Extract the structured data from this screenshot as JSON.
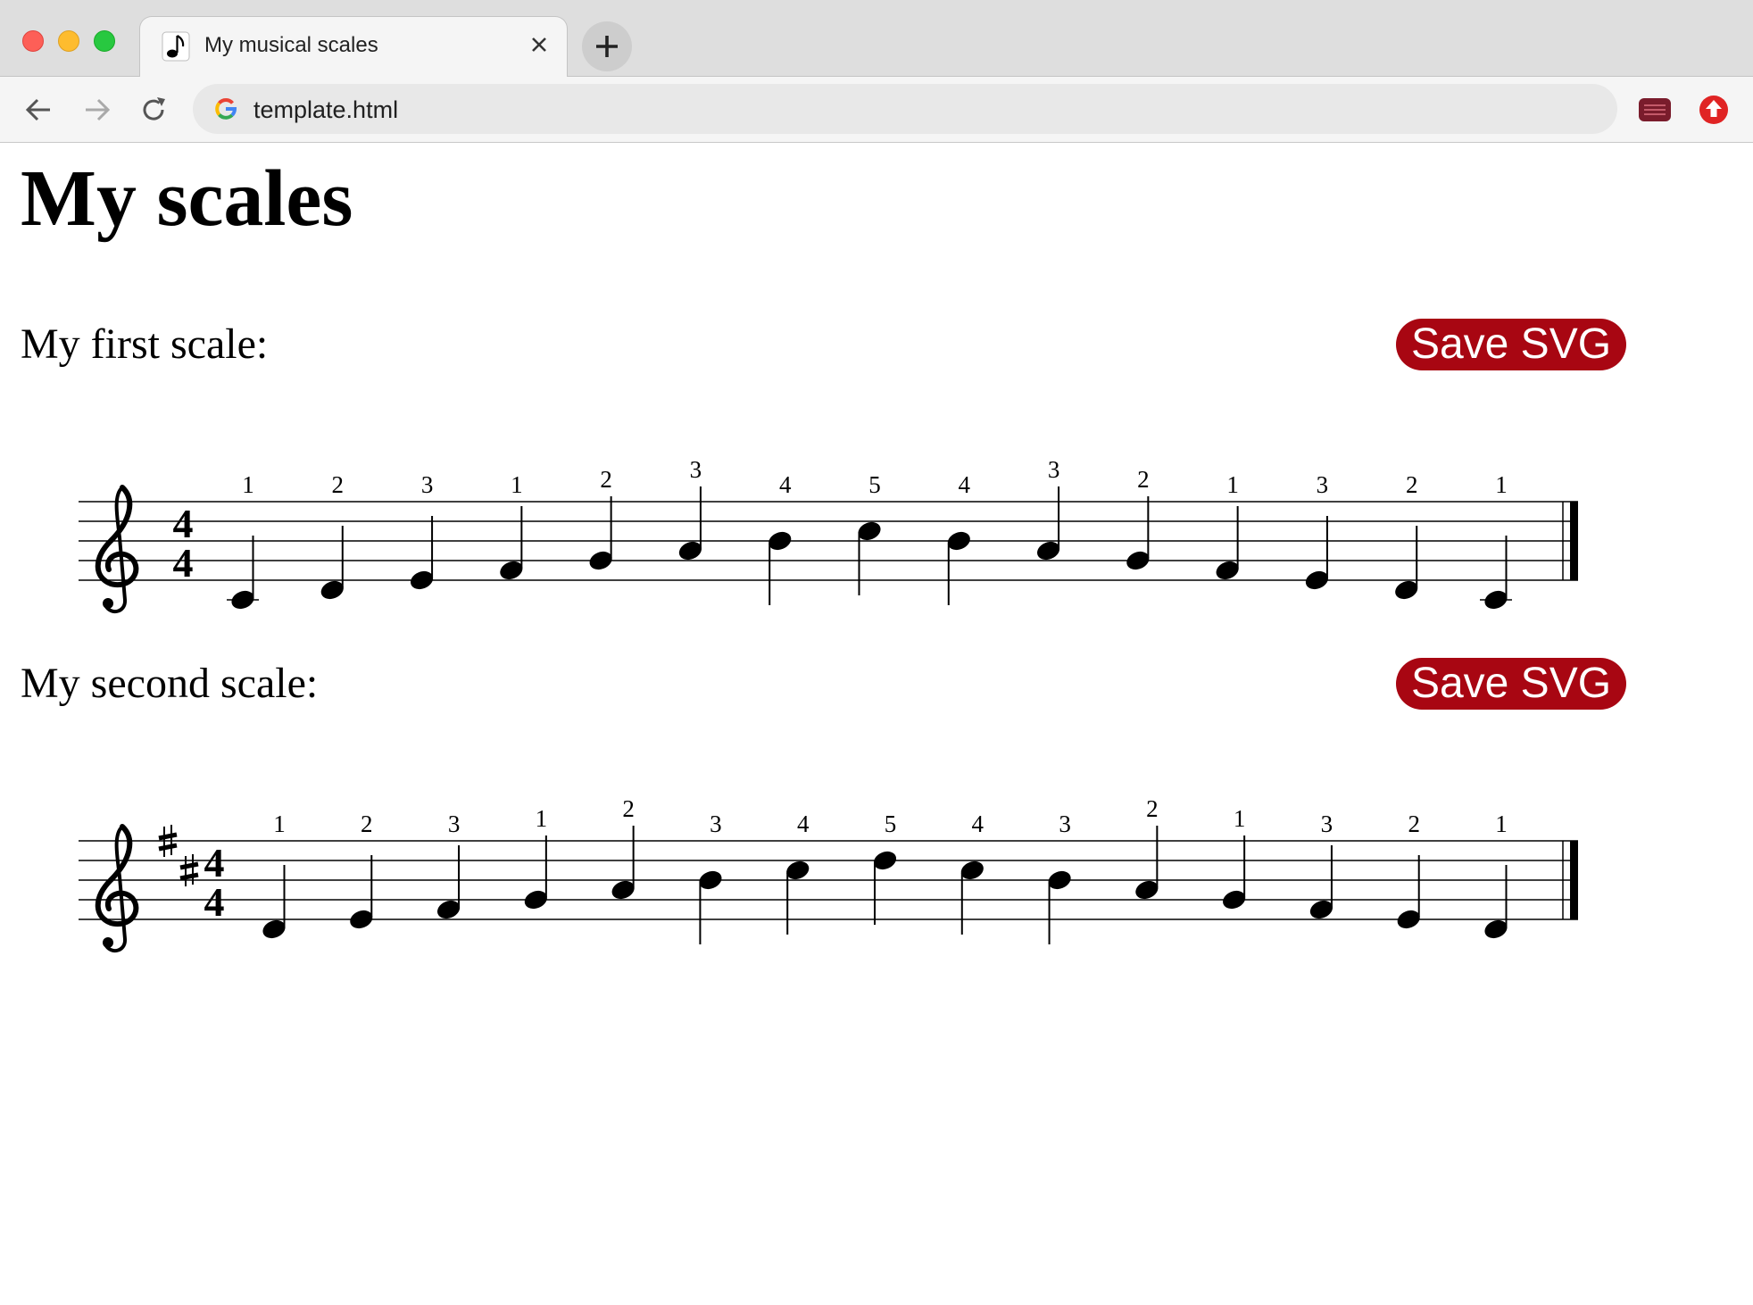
{
  "browser": {
    "tab_title": "My musical scales",
    "url": "template.html",
    "icons": {
      "favicon": "music-note-icon",
      "tab_close": "close-icon",
      "new_tab": "plus-icon",
      "back": "arrow-left-icon",
      "forward": "arrow-right-icon",
      "reload": "reload-icon",
      "site": "google-icon",
      "extension_1": "extension-red-icon",
      "extension_2": "upload-arrow-icon"
    }
  },
  "page": {
    "title": "My scales",
    "save_label": "Save SVG",
    "button_color": "#a80612"
  },
  "scales": [
    {
      "label": "My first scale:",
      "clef": "treble",
      "key_signature": [],
      "time_signature": [
        "4",
        "4"
      ],
      "notes": [
        {
          "pitch": "C4",
          "finger": "1"
        },
        {
          "pitch": "D4",
          "finger": "2"
        },
        {
          "pitch": "E4",
          "finger": "3"
        },
        {
          "pitch": "F4",
          "finger": "1"
        },
        {
          "pitch": "G4",
          "finger": "2"
        },
        {
          "pitch": "A4",
          "finger": "3"
        },
        {
          "pitch": "B4",
          "finger": "4"
        },
        {
          "pitch": "C5",
          "finger": "5"
        },
        {
          "pitch": "B4",
          "finger": "4"
        },
        {
          "pitch": "A4",
          "finger": "3"
        },
        {
          "pitch": "G4",
          "finger": "2"
        },
        {
          "pitch": "F4",
          "finger": "1"
        },
        {
          "pitch": "E4",
          "finger": "3"
        },
        {
          "pitch": "D4",
          "finger": "2"
        },
        {
          "pitch": "C4",
          "finger": "1"
        }
      ]
    },
    {
      "label": "My second scale:",
      "clef": "treble",
      "key_signature": [
        "F#",
        "C#"
      ],
      "time_signature": [
        "4",
        "4"
      ],
      "notes": [
        {
          "pitch": "D4",
          "finger": "1"
        },
        {
          "pitch": "E4",
          "finger": "2"
        },
        {
          "pitch": "F#4",
          "finger": "3"
        },
        {
          "pitch": "G4",
          "finger": "1"
        },
        {
          "pitch": "A4",
          "finger": "2"
        },
        {
          "pitch": "B4",
          "finger": "3"
        },
        {
          "pitch": "C#5",
          "finger": "4"
        },
        {
          "pitch": "D5",
          "finger": "5"
        },
        {
          "pitch": "C#5",
          "finger": "4"
        },
        {
          "pitch": "B4",
          "finger": "3"
        },
        {
          "pitch": "A4",
          "finger": "2"
        },
        {
          "pitch": "G4",
          "finger": "1"
        },
        {
          "pitch": "F#4",
          "finger": "3"
        },
        {
          "pitch": "E4",
          "finger": "2"
        },
        {
          "pitch": "D4",
          "finger": "1"
        }
      ]
    }
  ]
}
